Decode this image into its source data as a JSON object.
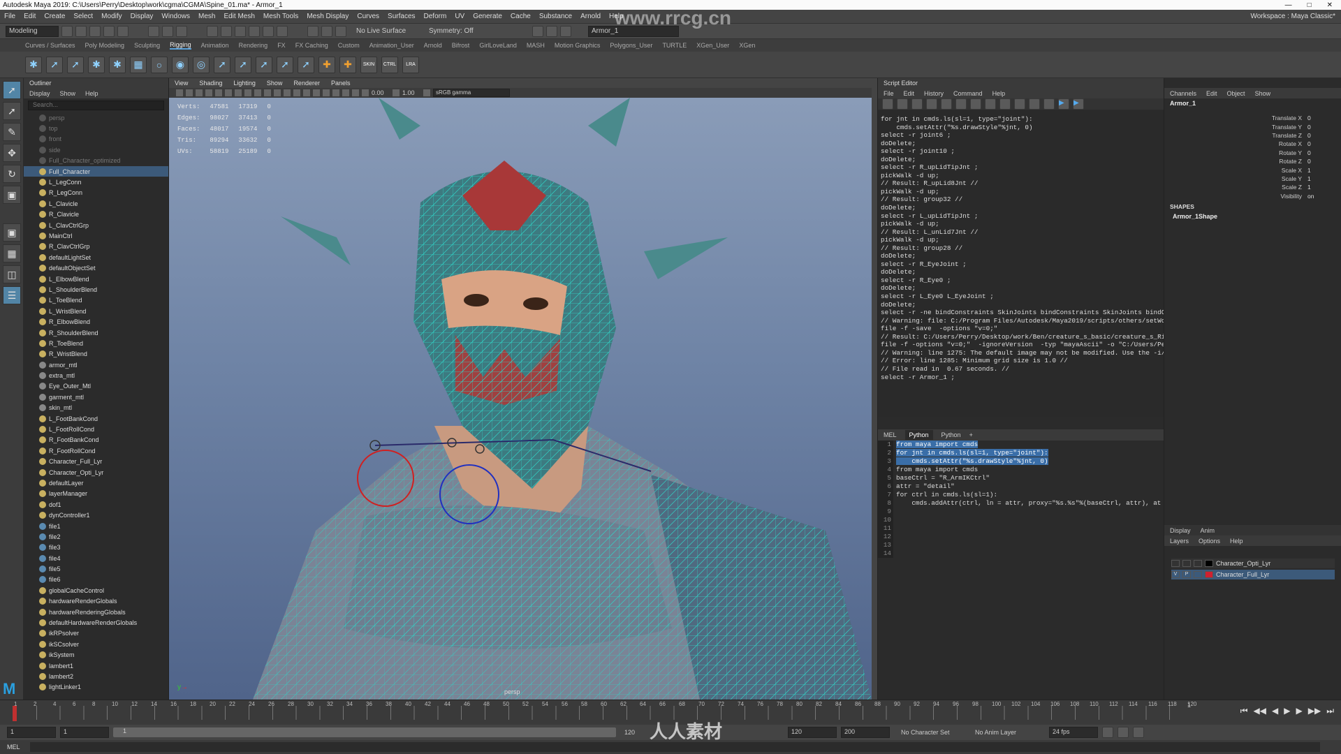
{
  "titlebar": {
    "text": "Autodesk Maya 2019: C:\\Users\\Perry\\Desktop\\work\\cgma\\CGMA\\Spine_01.ma* - Armor_1"
  },
  "menu": [
    "File",
    "Edit",
    "Create",
    "Select",
    "Modify",
    "Display",
    "Windows",
    "Mesh",
    "Edit Mesh",
    "Mesh Tools",
    "Mesh Display",
    "Curves",
    "Surfaces",
    "Deform",
    "UV",
    "Generate",
    "Cache",
    "Substance",
    "Arnold",
    "Help"
  ],
  "workspace": {
    "label": "Workspace :",
    "value": "Maya Classic*"
  },
  "status": {
    "mode": "Modeling",
    "live_surface": "No Live Surface",
    "symmetry": "Symmetry: Off",
    "object_field": "Armor_1"
  },
  "shelf_tabs": [
    "Curves / Surfaces",
    "Poly Modeling",
    "Sculpting",
    "Rigging",
    "Animation",
    "Rendering",
    "FX",
    "FX Caching",
    "Custom",
    "Animation_User",
    "Arnold",
    "Bifrost",
    "GirlLoveLand",
    "MASH",
    "Motion Graphics",
    "Polygons_User",
    "TURTLE",
    "XGen_User",
    "XGen"
  ],
  "shelf_active": "Rigging",
  "shelf_labels": [
    "SKIN",
    "CTRL",
    "LRA"
  ],
  "outliner": {
    "title": "Outliner",
    "menu": [
      "Display",
      "Show",
      "Help"
    ],
    "search_placeholder": "Search...",
    "items": [
      "persp",
      "top",
      "front",
      "side",
      "Full_Character_optimized",
      "Full_Character",
      "L_LegConn",
      "R_LegConn",
      "L_Clavicle",
      "R_Clavicle",
      "L_ClavCtrlGrp",
      "MainCtrl",
      "R_ClavCtrlGrp",
      "defaultLightSet",
      "defaultObjectSet",
      "L_ElbowBlend",
      "L_ShoulderBlend",
      "L_ToeBlend",
      "L_WristBlend",
      "R_ElbowBlend",
      "R_ShoulderBlend",
      "R_ToeBlend",
      "R_WristBlend",
      "armor_mtl",
      "extra_mtl",
      "Eye_Outer_Mtl",
      "garment_mtl",
      "skin_mtl",
      "L_FootBankCond",
      "L_FootRollCond",
      "R_FootBankCond",
      "R_FootRollCond",
      "Character_Full_Lyr",
      "Character_Opti_Lyr",
      "defaultLayer",
      "layerManager",
      "dof1",
      "dynController1",
      "file1",
      "file2",
      "file3",
      "file4",
      "file5",
      "file6",
      "globalCacheControl",
      "hardwareRenderGlobals",
      "hardwareRenderingGlobals",
      "defaultHardwareRenderGlobals",
      "ikRPsolver",
      "ikSCsolver",
      "ikSystem",
      "lambert1",
      "lambert2",
      "lightLinker1"
    ]
  },
  "viewport": {
    "menu": [
      "View",
      "Shading",
      "Lighting",
      "Show",
      "Renderer",
      "Panels"
    ],
    "exposure": "0.00",
    "gamma": "1.00",
    "colorspace": "sRGB gamma",
    "camera": "persp",
    "hud": [
      [
        "Verts:",
        "47581",
        "17319",
        "0"
      ],
      [
        "Edges:",
        "98027",
        "37413",
        "0"
      ],
      [
        "Faces:",
        "48017",
        "19574",
        "0"
      ],
      [
        "Tris:",
        "89294",
        "33632",
        "0"
      ],
      [
        "UVs:",
        "58819",
        "25189",
        "0"
      ]
    ]
  },
  "script_editor": {
    "title": "Script Editor",
    "menu": [
      "File",
      "Edit",
      "History",
      "Command",
      "Help"
    ],
    "history": [
      "for jnt in cmds.ls(sl=1, type=\"joint\"):",
      "    cmds.setAttr(\"%s.drawStyle\"%jnt, 0)",
      "select -r joint6 ;",
      "doDelete;",
      "select -r joint10 ;",
      "doDelete;",
      "select -r R_upLidTipJnt ;",
      "pickWalk -d up;",
      "// Result: R_upLid8Jnt //",
      "pickWalk -d up;",
      "// Result: group32 //",
      "doDelete;",
      "select -r L_upLidTipJnt ;",
      "pickWalk -d up;",
      "// Result: L_unLid7Jnt //",
      "pickWalk -d up;",
      "// Result: group28 //",
      "doDelete;",
      "select -r R_EyeJoint ;",
      "doDelete;",
      "select -r R_Eye0 ;",
      "doDelete;",
      "select -r L_Eye0 L_EyeJoint ;",
      "doDelete;",
      "select -r -ne bindConstraints SkinJoints bindConstraints SkinJoints bindC",
      "// Warning: file: C:/Program Files/Autodesk/Maya2019/scripts/others/setWo",
      "file -f -save  -options \"v=0;\"",
      "// Result: C:/Users/Perry/Desktop/work/Ben/creature_s_basic/creature_s_Ri",
      "file -f -options \"v=0;\"  -ignoreVersion  -typ \"mayaAscii\" -o \"C:/Users/Pe",
      "// Warning: line 1275: The default image may not be modified. Use the -i/",
      "// Error: line 1285: Minimum grid size is 1.0 //",
      "// File read in  0.67 seconds. //",
      "select -r Armor_1 ;"
    ],
    "tabs": [
      "MEL",
      "Python",
      "Python",
      "+"
    ],
    "active_tab": "Python",
    "code": [
      "from maya import cmds",
      "",
      "for jnt in cmds.ls(sl=1, type=\"joint\"):",
      "    cmds.setAttr(\"%s.drawStyle\"%jnt, 0)",
      "",
      "",
      "",
      "from maya import cmds",
      "",
      "baseCtrl = \"R_ArmIKCtrl\"",
      "attr = \"detail\"",
      "for ctrl in cmds.ls(sl=1):",
      "    cmds.addAttr(ctrl, ln = attr, proxy=\"%s.%s\"%(baseCtrl, attr), at",
      ""
    ]
  },
  "channel_box": {
    "menu": [
      "Channels",
      "Edit",
      "Object",
      "Show"
    ],
    "object": "Armor_1",
    "channels": [
      [
        "Translate X",
        "0"
      ],
      [
        "Translate Y",
        "0"
      ],
      [
        "Translate Z",
        "0"
      ],
      [
        "Rotate X",
        "0"
      ],
      [
        "Rotate Y",
        "0"
      ],
      [
        "Rotate Z",
        "0"
      ],
      [
        "Scale X",
        "1"
      ],
      [
        "Scale Y",
        "1"
      ],
      [
        "Scale Z",
        "1"
      ],
      [
        "Visibility",
        "on"
      ]
    ],
    "shapes_label": "SHAPES",
    "shape": "Armor_1Shape"
  },
  "layer_editor": {
    "tabs": [
      "Display",
      "Anim"
    ],
    "menu": [
      "Layers",
      "Options",
      "Help"
    ],
    "layers": [
      {
        "name": "Character_Opti_Lyr",
        "color": "#000000"
      },
      {
        "name": "Character_Full_Lyr",
        "color": "#d02030"
      }
    ],
    "vis": "V",
    "playback": "P"
  },
  "timeline": {
    "ticks": [
      "1",
      "2",
      "4",
      "6",
      "8",
      "10",
      "12",
      "14",
      "16",
      "18",
      "20",
      "22",
      "24",
      "26",
      "28",
      "30",
      "32",
      "34",
      "36",
      "38",
      "40",
      "42",
      "44",
      "46",
      "48",
      "50",
      "52",
      "54",
      "56",
      "58",
      "60",
      "62",
      "64",
      "66",
      "68",
      "70",
      "72",
      "74",
      "76",
      "78",
      "80",
      "82",
      "84",
      "86",
      "88",
      "90",
      "92",
      "94",
      "96",
      "98",
      "100",
      "102",
      "104",
      "106",
      "108",
      "110",
      "112",
      "114",
      "116",
      "118",
      "120"
    ],
    "current": "1"
  },
  "range": {
    "start": "1",
    "inner_start": "1",
    "slider_start": "1",
    "slider_end": "120",
    "end": "120",
    "max": "200",
    "char_set": "No Character Set",
    "anim_layer": "No Anim Layer",
    "fps": "24 fps"
  },
  "cmdline": {
    "label": "MEL"
  },
  "watermarks": [
    "www.rrcg.cn",
    "人人素材"
  ]
}
